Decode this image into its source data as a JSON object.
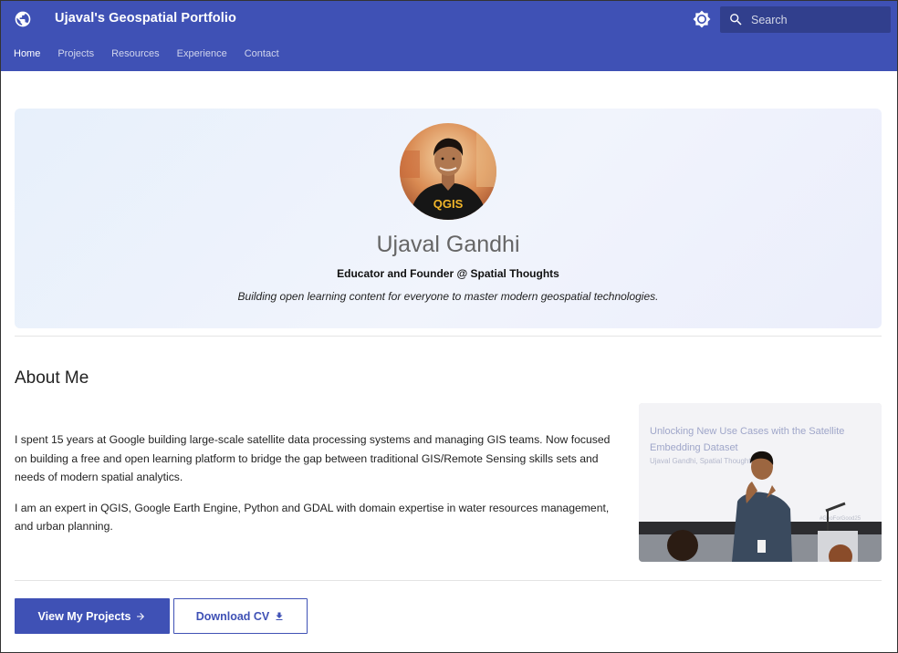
{
  "header": {
    "site_title": "Ujaval's Geospatial Portfolio",
    "logo_icon": "globe-icon",
    "theme_icon": "brightness-icon",
    "search": {
      "placeholder": "Search",
      "value": ""
    },
    "tabs": [
      {
        "label": "Home",
        "active": true
      },
      {
        "label": "Projects",
        "active": false
      },
      {
        "label": "Resources",
        "active": false
      },
      {
        "label": "Experience",
        "active": false
      },
      {
        "label": "Contact",
        "active": false
      }
    ],
    "colors": {
      "primary": "#3f51b5"
    }
  },
  "hero": {
    "name": "Ujaval Gandhi",
    "role": "Educator and Founder @ Spatial Thoughts",
    "tagline": "Building open learning content for everyone to master modern geospatial technologies.",
    "avatar_shirt_text": "QGIS"
  },
  "about": {
    "title": "About Me",
    "paragraphs": [
      "I spent 15 years at Google building large-scale satellite data processing systems and managing GIS teams. Now focused on building a free and open learning platform to bridge the gap between traditional GIS/Remote Sensing skills sets and needs of modern spatial analytics.",
      "I am an expert in QGIS, Google Earth Engine, Python and GDAL with domain expertise in water resources management, and urban planning."
    ],
    "photo": {
      "slide_title": "Unlocking New Use Cases with the Satellite Embedding Dataset",
      "slide_subtitle": "Ujaval Gandhi, Spatial Thoughts",
      "slide_hashtag": "#GeoForGood25"
    }
  },
  "actions": {
    "view_projects": "View My Projects",
    "view_projects_icon": "arrow-right-icon",
    "download_cv": "Download CV",
    "download_cv_icon": "download-icon"
  }
}
